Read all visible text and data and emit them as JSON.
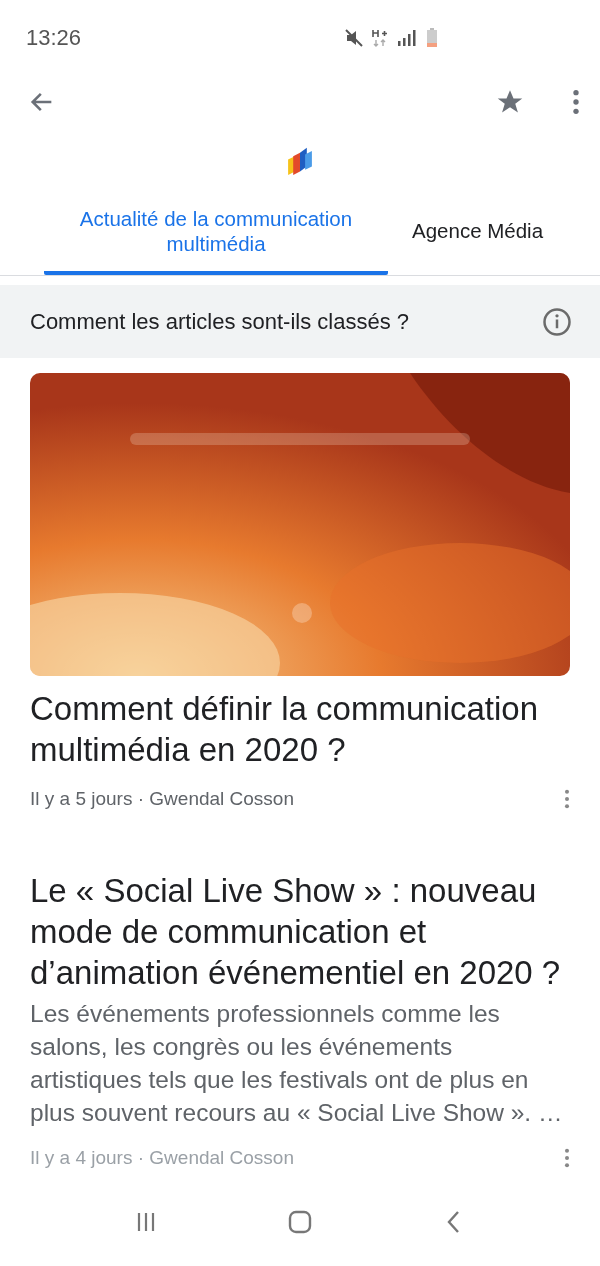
{
  "status_bar": {
    "time": "13:26"
  },
  "tabs": [
    {
      "label": "Actualité de la communication multimédia",
      "selected": true
    },
    {
      "label": "Agence Média",
      "selected": false
    }
  ],
  "ranking_banner": {
    "text": "Comment les articles sont-ils classés ?"
  },
  "articles": [
    {
      "kind": "hero",
      "title": "Comment définir la communication multimédia en 2020 ?",
      "meta": "Il y a 5 jours · Gwendal Cosson"
    },
    {
      "kind": "text",
      "title": "Le « Social Live Show » : nouveau mode de communication et d’animation événementiel en 2020 ?",
      "snippet": "Les événements professionnels comme les salons, les congrès ou les événements artistiques tels que les festivals ont de plus en plus souvent recours au « Social Live Show ». …",
      "meta": "Il y a 4 jours · Gwendal Cosson"
    }
  ]
}
